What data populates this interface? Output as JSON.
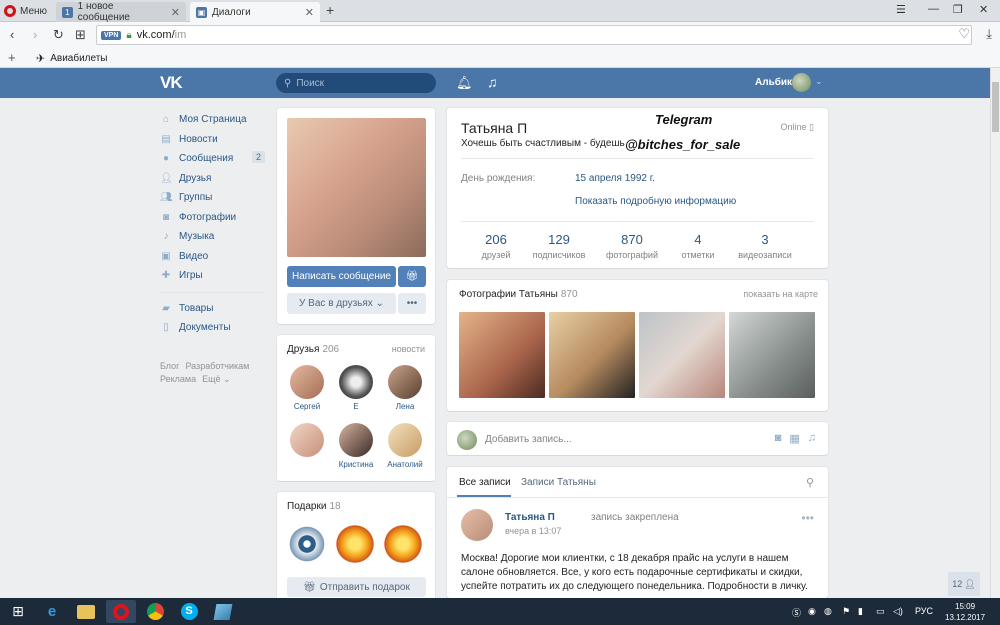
{
  "browser": {
    "menu_label": "Меню",
    "tabs": [
      {
        "label": "1 новое сообщение",
        "badge": "1"
      },
      {
        "label": "Диалоги"
      }
    ],
    "url_host": "vk.com/",
    "url_path": "im",
    "vpn_label": "VPN",
    "bookmarks": [
      {
        "label": "Авиабилеты"
      }
    ]
  },
  "header": {
    "logo": "VK",
    "search_placeholder": "Поиск",
    "user_name": "Альбик"
  },
  "nav": {
    "items": [
      {
        "label": "Моя Страница",
        "icon": "home-icon"
      },
      {
        "label": "Новости",
        "icon": "news-icon"
      },
      {
        "label": "Сообщения",
        "icon": "messages-icon",
        "badge": "2"
      },
      {
        "label": "Друзья",
        "icon": "friends-icon"
      },
      {
        "label": "Группы",
        "icon": "groups-icon"
      },
      {
        "label": "Фотографии",
        "icon": "camera-icon"
      },
      {
        "label": "Музыка",
        "icon": "music-icon"
      },
      {
        "label": "Видео",
        "icon": "video-icon"
      },
      {
        "label": "Игры",
        "icon": "games-icon"
      }
    ],
    "items2": [
      {
        "label": "Товары",
        "icon": "goods-icon"
      },
      {
        "label": "Документы",
        "icon": "documents-icon"
      }
    ],
    "footer": [
      "Блог",
      "Разработчикам",
      "Реклама",
      "Ещё ⌄"
    ]
  },
  "profile_actions": {
    "message_button": "Написать сообщение",
    "friend_button": "У Вас в друзьях ⌄",
    "more_button": "•••"
  },
  "friends": {
    "title": "Друзья",
    "count": "206",
    "link": "новости",
    "items": [
      {
        "name": "Сергей"
      },
      {
        "name": "Е"
      },
      {
        "name": "Лена"
      },
      {
        "name": ""
      },
      {
        "name": "Кристина"
      },
      {
        "name": "Анатолий"
      }
    ]
  },
  "gifts": {
    "title": "Подарки",
    "count": "18",
    "send_button": "Отправить подарок"
  },
  "profile": {
    "name": "Татьяна П",
    "status": "Хочешь быть счастливым - будешь",
    "online": "Online",
    "watermark_1": "Telegram",
    "watermark_2": "@bitches_for_sale",
    "birthday_label": "День рождения:",
    "birthday_value": "15 апреля 1992 г.",
    "more_info": "Показать подробную информацию",
    "counters": [
      {
        "num": "206",
        "label": "друзей"
      },
      {
        "num": "129",
        "label": "подписчиков"
      },
      {
        "num": "870",
        "label": "фотографий"
      },
      {
        "num": "4",
        "label": "отметки"
      },
      {
        "num": "3",
        "label": "видеозаписи"
      }
    ]
  },
  "photos": {
    "title": "Фотографии Татьяны",
    "count": "870",
    "link": "показать на карте"
  },
  "post_box": {
    "placeholder": "Добавить запись..."
  },
  "wall": {
    "tab_all": "Все записи",
    "tab_own": "Записи Татьяны",
    "post": {
      "author": "Татьяна П",
      "action": "запись закреплена",
      "time": "вчера в 13:07",
      "text": "Москва! Дорогие мои клиентки, с 18 декабря прайс на услуги в нашем салоне обновляется. Все, у кого есть подарочные сертификаты и скидки, успейте потратить их до следующего понедельника. Подробности в личку."
    }
  },
  "chat_badge": "12",
  "taskbar": {
    "lang": "РУС",
    "time": "15:09",
    "date": "13.12.2017"
  }
}
